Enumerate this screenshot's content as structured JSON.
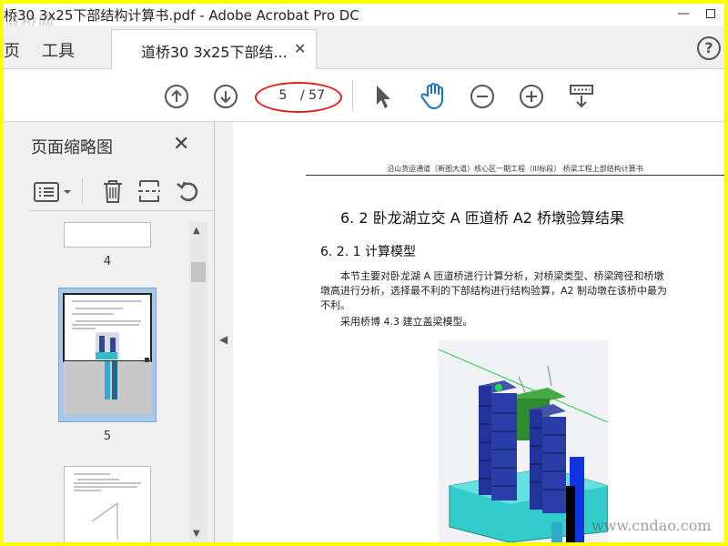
{
  "window": {
    "title": "桥30 3x25下部结构计算书.pdf - Adobe Acrobat Pro DC",
    "minimize_glyph": "—",
    "watermark_top": "道桥网"
  },
  "tabs": {
    "home_label": "页",
    "tools_label": "工具",
    "document_label": "道桥30 3x25下部结...",
    "close_glyph": "✕",
    "help_glyph": "?"
  },
  "toolbar": {
    "current_page": "5",
    "total_pages": "/ 57",
    "icons": [
      "arrow-up-circle-icon",
      "arrow-down-circle-icon",
      "select-pointer-icon",
      "hand-tool-icon",
      "zoom-out-icon",
      "zoom-in-icon",
      "keyboard-tools-icon"
    ],
    "highlight_color": "#e02020",
    "active_color": "#1a73c8"
  },
  "thumbnail_pane": {
    "title": "页面缩略图",
    "close_glyph": "✕",
    "pages": [
      {
        "number": "4"
      },
      {
        "number": "5"
      }
    ],
    "selected_color": "#a8c8e8"
  },
  "document": {
    "header": "沿山货运通道（新图大道）核心区一期工程（III标段） 桥梁工程上部结构计算书",
    "heading1": "6. 2 卧龙湖立交 A 匝道桥 A2 桥墩验算结果",
    "heading2": "6. 2. 1 计算模型",
    "para1_line1": "本节主要对卧龙湖 A 匝道桥进行计算分析，对桥梁类型、桥梁跨径和桥墩",
    "para1_line2": "墩高进行分析，选择最不利的下部结构进行结构验算，A2 制动墩在该桥中最为",
    "para1_line3": "不利。",
    "para2": "采用桥博 4.3 建立盖梁模型。"
  },
  "watermark_bottom": "www.cndao.com"
}
